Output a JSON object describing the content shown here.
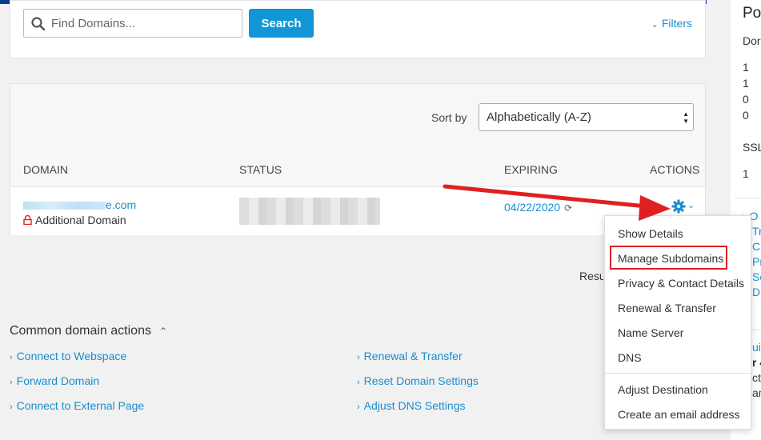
{
  "search": {
    "placeholder": "Find Domains...",
    "button_label": "Search",
    "filters_label": "Filters"
  },
  "list": {
    "sort_label": "Sort by",
    "sort_value": "Alphabetically (A-Z)",
    "columns": {
      "domain": "DOMAIN",
      "status": "STATUS",
      "expiring": "EXPIRING",
      "actions": "ACTIONS"
    },
    "row": {
      "domain_suffix": "e.com",
      "domain_type": "Additional Domain",
      "expiring": "04/22/2020"
    }
  },
  "actions_menu": {
    "items": [
      "Show Details",
      "Manage Subdomains",
      "Privacy & Contact Details",
      "Renewal & Transfer",
      "Name Server",
      "DNS"
    ],
    "items_bottom": [
      "Adjust Destination",
      "Create an email address"
    ],
    "highlighted": "Manage Subdomains"
  },
  "results_label": "Resul",
  "common_actions": {
    "title": "Common domain actions",
    "left_links": [
      "Connect to Webspace",
      "Forward Domain",
      "Connect to External Page"
    ],
    "right_links": [
      "Renewal & Transfer",
      "Reset Domain Settings",
      "Adjust DNS Settings"
    ]
  },
  "right_panel": {
    "title": "Po",
    "subtitle": "Dor",
    "counts": [
      "1",
      "1",
      "0",
      "0"
    ],
    "ssl_label": "SSL",
    "ssl_count": "1",
    "links": [
      "O",
      "Tr",
      "Cr",
      "Pr",
      "Se",
      "D"
    ],
    "bottom": [
      "uic",
      "r 4",
      "ct",
      "and"
    ]
  },
  "colors": {
    "accent": "#1196d6",
    "link": "#1a8dd0",
    "highlight": "#e02020",
    "topbar": "#0a3d91"
  }
}
